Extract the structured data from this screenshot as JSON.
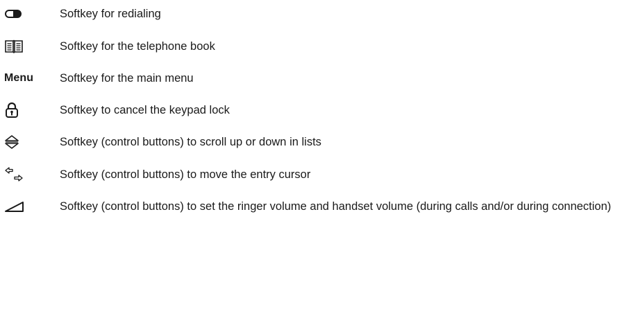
{
  "softkeys": [
    {
      "icon": "redial-icon",
      "description": "Softkey for redialing"
    },
    {
      "icon": "telephone-book-icon",
      "description": "Softkey for the telephone book"
    },
    {
      "symbol_text": "Menu",
      "description": "Softkey for the main menu"
    },
    {
      "icon": "padlock-icon",
      "description": "Softkey to cancel the keypad lock"
    },
    {
      "icon": "scroll-up-down-icon",
      "description": "Softkey (control buttons) to scroll up or down in lists"
    },
    {
      "icon": "cursor-left-right-icon",
      "description": "Softkey (control buttons) to move the entry cursor"
    },
    {
      "icon": "volume-icon",
      "description": "Softkey (control buttons) to set the ringer volume and handset volume (during calls and/or during connection)"
    }
  ]
}
